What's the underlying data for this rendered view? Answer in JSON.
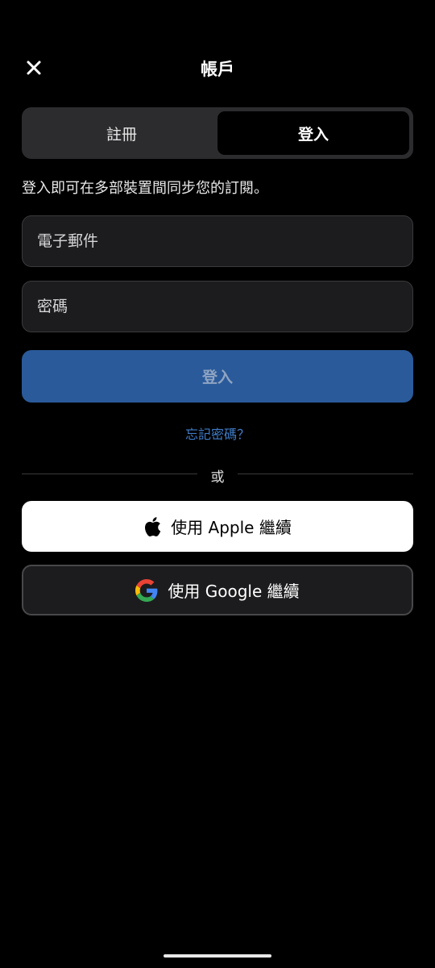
{
  "header": {
    "title": "帳戶",
    "close_icon": "close-icon"
  },
  "tabs": [
    {
      "label": "註冊",
      "selected": false
    },
    {
      "label": "登入",
      "selected": true
    }
  ],
  "description": "登入即可在多部裝置間同步您的訂閱。",
  "form": {
    "email_placeholder": "電子郵件",
    "password_placeholder": "密碼",
    "submit_label": "登入",
    "forgot_label": "忘記密碼？"
  },
  "divider_text": "或",
  "social": {
    "apple_label": "使用 Apple 繼續",
    "apple_icon": "apple-icon",
    "google_label": "使用 Google 繼續",
    "google_icon": "google-icon"
  },
  "colors": {
    "background": "#000000",
    "primary_button": "#2a5a9a",
    "link": "#3f7cc8",
    "field_background": "#1c1c1e"
  }
}
